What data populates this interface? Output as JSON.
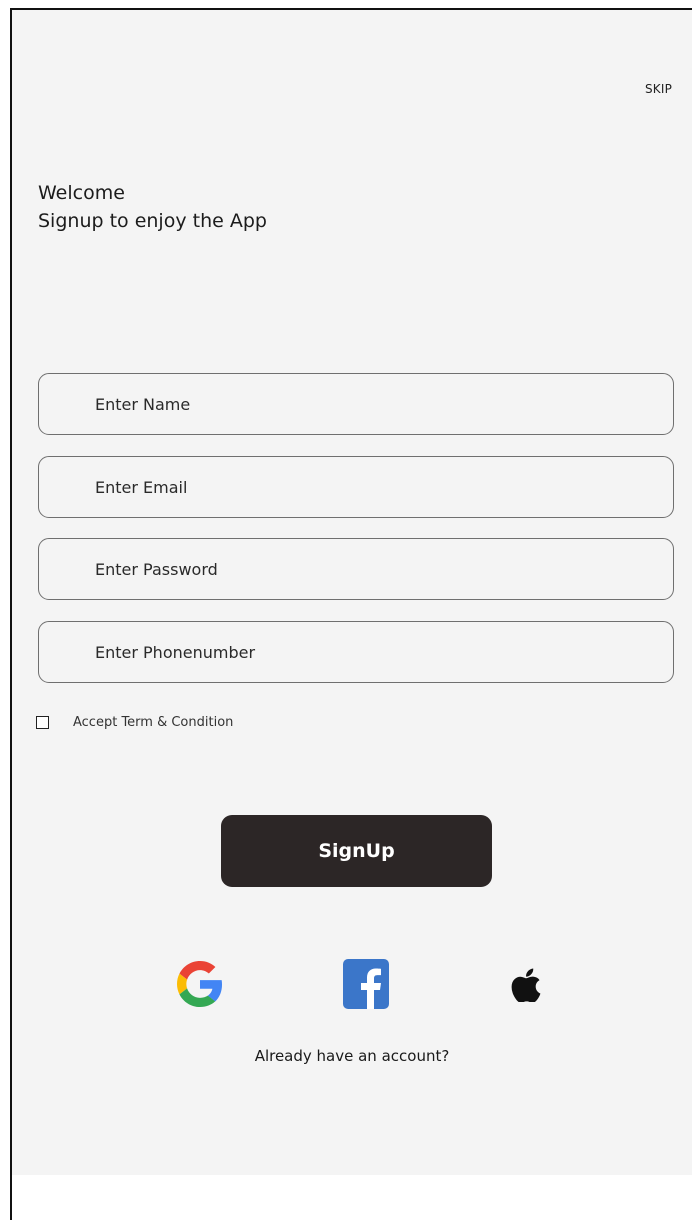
{
  "header": {
    "skip_label": "SKIP"
  },
  "intro": {
    "title": "Welcome",
    "subtitle": "Signup to enjoy the App"
  },
  "form": {
    "name_placeholder": "Enter Name",
    "email_placeholder": "Enter Email",
    "password_placeholder": "Enter Password",
    "phone_placeholder": "Enter Phonenumber",
    "terms_label": "Accept Term & Condition",
    "terms_checked": false
  },
  "actions": {
    "signup_label": "SignUp",
    "login_prompt": "Already have an account?"
  },
  "social": {
    "providers": [
      "google-icon",
      "facebook-icon",
      "apple-icon"
    ]
  },
  "colors": {
    "background": "#f4f4f4",
    "button": "#2c2626",
    "facebook_blue": "#3b76c9",
    "google_blue": "#4285F4",
    "google_red": "#EA4335",
    "google_yellow": "#FBBC05",
    "google_green": "#34A853"
  }
}
